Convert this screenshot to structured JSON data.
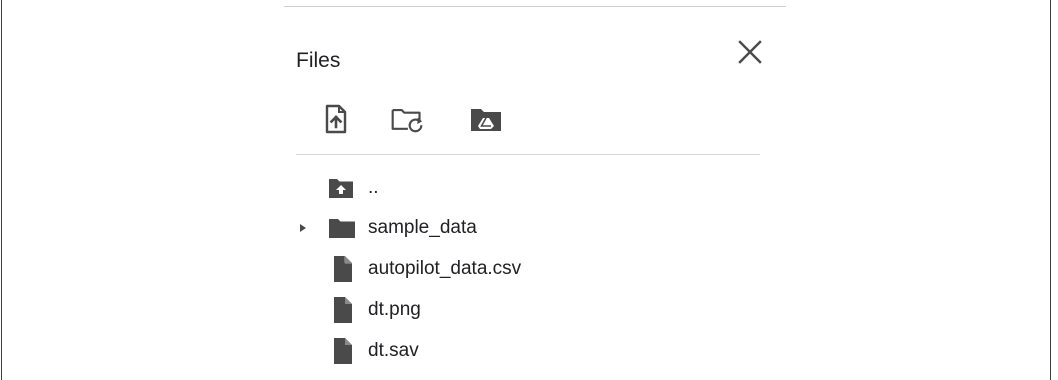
{
  "panel": {
    "title": "Files",
    "close_icon": "close-icon"
  },
  "toolbar": [
    {
      "name": "upload-file-button",
      "icon": "file-upload-icon"
    },
    {
      "name": "refresh-folder-button",
      "icon": "folder-refresh-icon"
    },
    {
      "name": "mount-drive-button",
      "icon": "drive-folder-icon"
    }
  ],
  "tree": {
    "items": [
      {
        "label": "..",
        "icon": "folder-up-icon",
        "expandable": false
      },
      {
        "label": "sample_data",
        "icon": "folder-icon",
        "expandable": true
      },
      {
        "label": "autopilot_data.csv",
        "icon": "file-icon",
        "expandable": false
      },
      {
        "label": "dt.png",
        "icon": "file-icon",
        "expandable": false
      },
      {
        "label": "dt.sav",
        "icon": "file-icon",
        "expandable": false
      }
    ]
  },
  "colors": {
    "icon": "#4a4a4a",
    "text": "#202124",
    "divider": "#d6d6d6"
  }
}
